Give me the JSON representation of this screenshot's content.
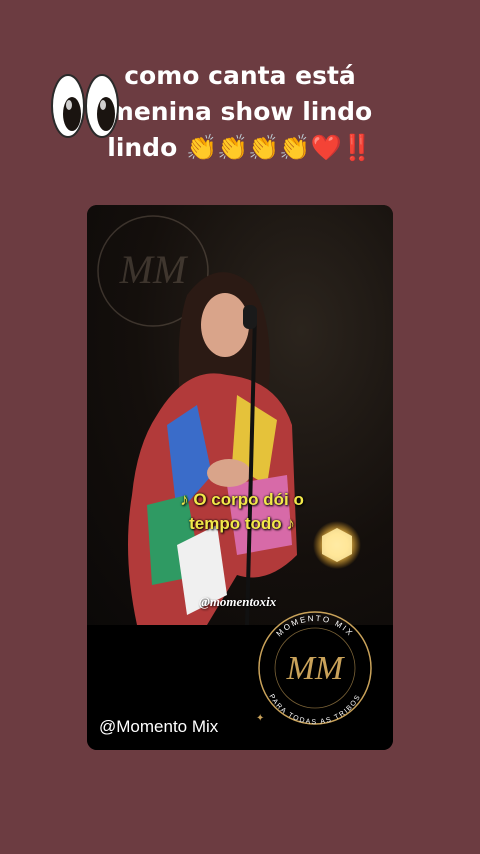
{
  "caption": {
    "line1": "como canta está",
    "line2": "menina show lindo",
    "line3": "lindo 👏👏👏👏❤️‼️",
    "eyes_icon": "eyes-emoji-icon"
  },
  "video": {
    "subtitle_line1": "♪ O corpo dói o",
    "subtitle_line2": "tempo todo ♪",
    "watermark": "@momentoxix",
    "handle": "@Momento Mix"
  },
  "logo": {
    "initials": "MM",
    "ring_top": "MOMENTO MIX",
    "ring_bottom": "PARA TODAS AS TRIBOS",
    "color": "#c9a25a"
  },
  "colors": {
    "background": "#6c3c41",
    "subtitle": "#f2e84a"
  }
}
